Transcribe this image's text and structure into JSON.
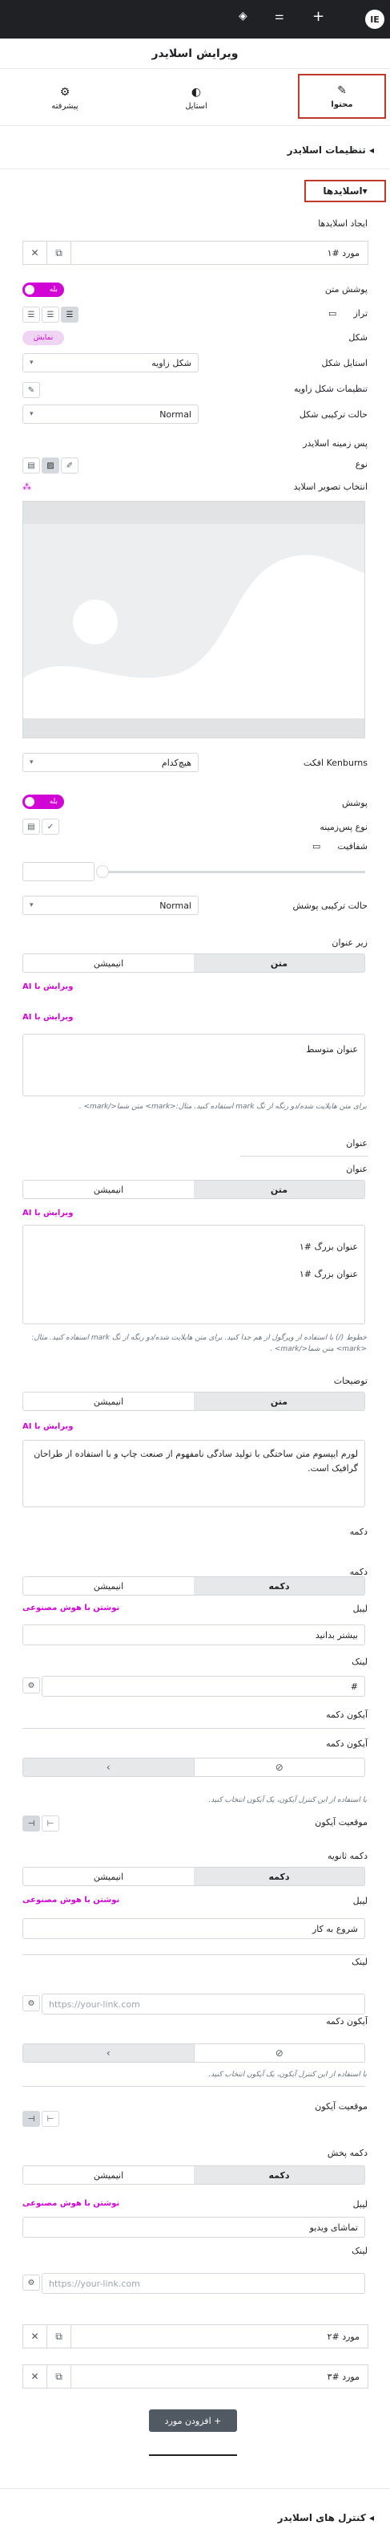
{
  "topbar": {
    "bg": "#1f2124",
    "icons": [
      "elementor-logo-icon",
      "plus-icon",
      "sliders-icon",
      "layers-icon"
    ]
  },
  "header": {
    "title": "ویرایش اسلایدر"
  },
  "panel_tabs": [
    {
      "label": "محتوا",
      "icon": "pencil-icon"
    },
    {
      "label": "استایل",
      "icon": "contrast-icon"
    },
    {
      "label": "پیشرفته",
      "icon": "gear-icon"
    }
  ],
  "sections": {
    "slider_settings": "تنظیمات اسلایدر",
    "slides": "اسلایدها",
    "slider_controls": "کنترل های اسلایدر"
  },
  "create_slides": "ایجاد اسلایدها",
  "item1": {
    "title": "مورد #۱"
  },
  "fields": {
    "full_content": "پوشش متن",
    "toggle_yes": "بله",
    "align": "تراز",
    "shape": "شکل",
    "shape_badge": "نمایش",
    "shape_style": "استایل شکل",
    "shape_style_value": "شکل زاویه",
    "shape_settings": "تنظیمات شکل زاویه",
    "shape_blend": "حالت ترکیبی شکل",
    "blend_value": "Normal",
    "bg": "پس زمینه اسلایدر",
    "type": "نوع",
    "img_select": "انتخاب تصویر اسلاید",
    "kenburns": "افکت Kenburns",
    "kenburns_value": "هیچ‌کدام",
    "overlay": "پوشش",
    "overlay_type": "نوع پس‌زمینه",
    "opacity": "شفافیت",
    "overlay_blend": "حالت ترکیبی پوشش"
  },
  "subtitle": {
    "label": "زیر عنوان",
    "tab_text": "متن",
    "tab_anim": "انیمیشن",
    "ai1": "ویرایش با AI",
    "ai2": "ویرایش با AI",
    "value": "عنوان متوسط",
    "help": "برای متن هایلایت شده/دو رنگه از تگ mark استفاده کنید. مثال:<mark> متن شما</mark> ."
  },
  "title": {
    "label": "عنوان",
    "label2": "عنوان",
    "tab_text": "متن",
    "tab_anim": "انیمیشن",
    "ai": "ویرایش با AI",
    "line1": "عنوان بزرگ #۱",
    "line2": "عنوان بزرگ #۱",
    "help": "خطوط (/) با استفاده از ویرگول از هم جدا کنید. برای متن هایلایت شده/دو رنگه از تگ mark استفاده کنید. مثال:<mark> متن شما</mark> ."
  },
  "desc": {
    "label": "توضیحات",
    "tab_text": "متن",
    "tab_anim": "انیمیشن",
    "ai": "ویرایش با AI",
    "value": "لورم ایپسوم متن ساختگی با تولید سادگی نامفهوم از صنعت چاپ و با استفاده از طراحان گرافیک است."
  },
  "button": {
    "section": "دکمه",
    "section2": "دکمه",
    "tab_btn": "دکمه",
    "tab_anim": "انیمیشن",
    "label": "لیبل",
    "ai": "نوشتن با هوش مصنوعی",
    "value": "بیشتر بدانید",
    "link": "لینک",
    "link_value": "#",
    "icon_label": "آیکون دکمه",
    "icon_label2": "آیکون دکمه",
    "help": "با استفاده از این کنترل آیکون، یک آیکون انتخاب کنید.",
    "pos": "موقعیت آیکون"
  },
  "button2": {
    "section": "دکمه ثانویه",
    "tab_btn": "دکمه",
    "tab_anim": "انیمیشن",
    "label": "لیبل",
    "ai": "نوشتن با هوش مصنوعی",
    "value": "شروع به کار",
    "link": "لینک",
    "link_ph": "https://your-link.com",
    "icon_label": "آیکون دکمه",
    "help": "با استفاده از این کنترل آیکون، یک آیکون انتخاب کنید.",
    "pos": "موقعیت آیکون"
  },
  "button3": {
    "section": "دکمه پخش",
    "tab_btn": "دکمه",
    "tab_anim": "انیمیشن",
    "label": "لیبل",
    "ai": "نوشتن با هوش مصنوعی",
    "value": "تماشای ویدیو",
    "link": "لینک",
    "link_ph": "https://your-link.com"
  },
  "items": [
    {
      "title": "مورد #۲"
    },
    {
      "title": "مورد #۳"
    }
  ],
  "add_item": "+  افزودن مورد",
  "colors": {
    "accent": "#d004d4",
    "highlight": "#c0392b",
    "dark": "#1f2124",
    "border": "#d5d8dc"
  }
}
